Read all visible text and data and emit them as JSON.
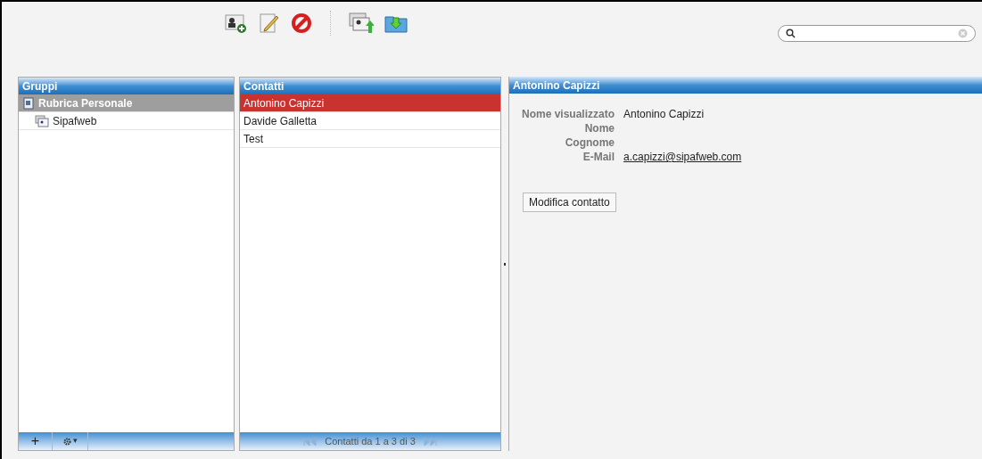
{
  "groups": {
    "title": "Gruppi",
    "items": [
      {
        "label": "Rubrica Personale",
        "selected": true,
        "kind": "addressbook",
        "children": [
          {
            "label": "Sipafweb",
            "selected": false,
            "kind": "group"
          }
        ]
      }
    ],
    "footer": {
      "add": "+",
      "settings": "▾"
    }
  },
  "contacts": {
    "title": "Contatti",
    "items": [
      {
        "name": "Antonino Capizzi",
        "selected": true
      },
      {
        "name": "Davide Galletta",
        "selected": false
      },
      {
        "name": "Test",
        "selected": false
      }
    ],
    "pager": "Contatti da 1 a 3 di 3"
  },
  "detail": {
    "title": "Antonino Capizzi",
    "fields": [
      {
        "label": "Nome visualizzato",
        "value": "Antonino Capizzi",
        "kind": "text"
      },
      {
        "label": "Nome"
      },
      {
        "label": "Cognome"
      },
      {
        "label": "E-Mail",
        "value": "a.capizzi@sipafweb.com",
        "kind": "link"
      }
    ],
    "button": "Modifica contatto"
  }
}
